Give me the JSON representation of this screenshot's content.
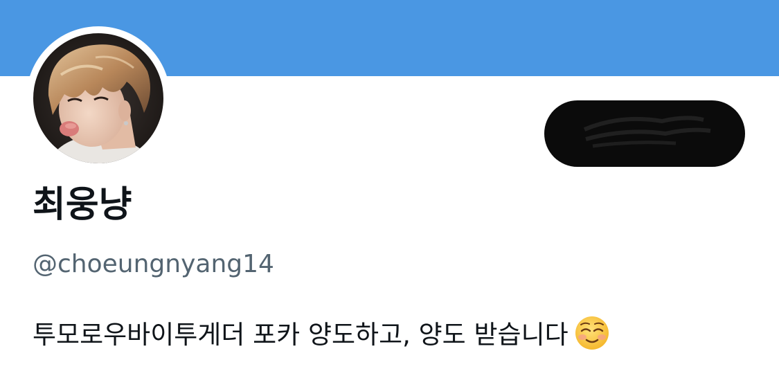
{
  "header": {
    "banner_color": "#4a97e3"
  },
  "profile": {
    "avatar_icon": "profile-photo",
    "display_name": "최웅냥",
    "handle": "@choeungnyang14",
    "bio_text": "투모로우바이투게더 포카 양도하고, 양도 받습니다",
    "bio_emoji": "smiling-face-emoji"
  },
  "action_button": {
    "state": "redacted"
  }
}
